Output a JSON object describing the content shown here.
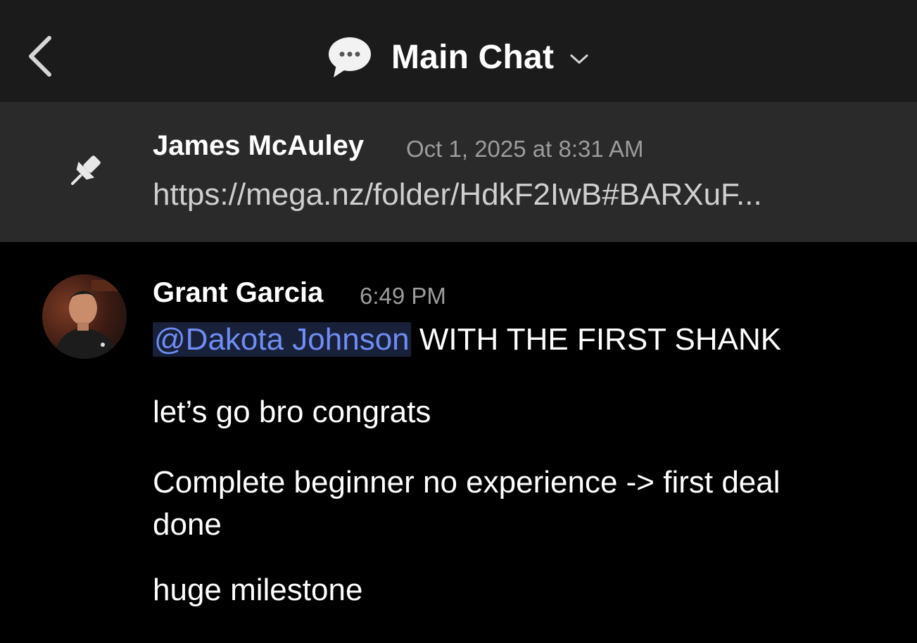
{
  "header": {
    "title": "Main Chat",
    "icons": {
      "back": "chevron-left-icon",
      "channel": "chat-bubble-icon",
      "dropdown": "chevron-down-icon"
    }
  },
  "pinned": {
    "icon": "pin-icon",
    "author": "James McAuley",
    "timestamp": "Oct 1, 2025 at 8:31 AM",
    "text": "https://mega.nz/folder/HdkF2IwB#BARXuF..."
  },
  "message": {
    "author": "Grant Garcia",
    "timestamp": "6:49 PM",
    "mention": "@Dakota Johnson",
    "line1_rest": " WITH THE FIRST SHANK",
    "line2": "let’s go bro congrats",
    "line3": "Complete beginner no experience -> first deal done",
    "line4": "huge milestone"
  },
  "colors": {
    "header_bg": "#1b1b1b",
    "pinned_bg": "#2a2a2a",
    "body_bg": "#000000",
    "mention_text": "#6f8df2",
    "mention_bg": "#18203a",
    "muted_text": "#9c9c9c"
  }
}
